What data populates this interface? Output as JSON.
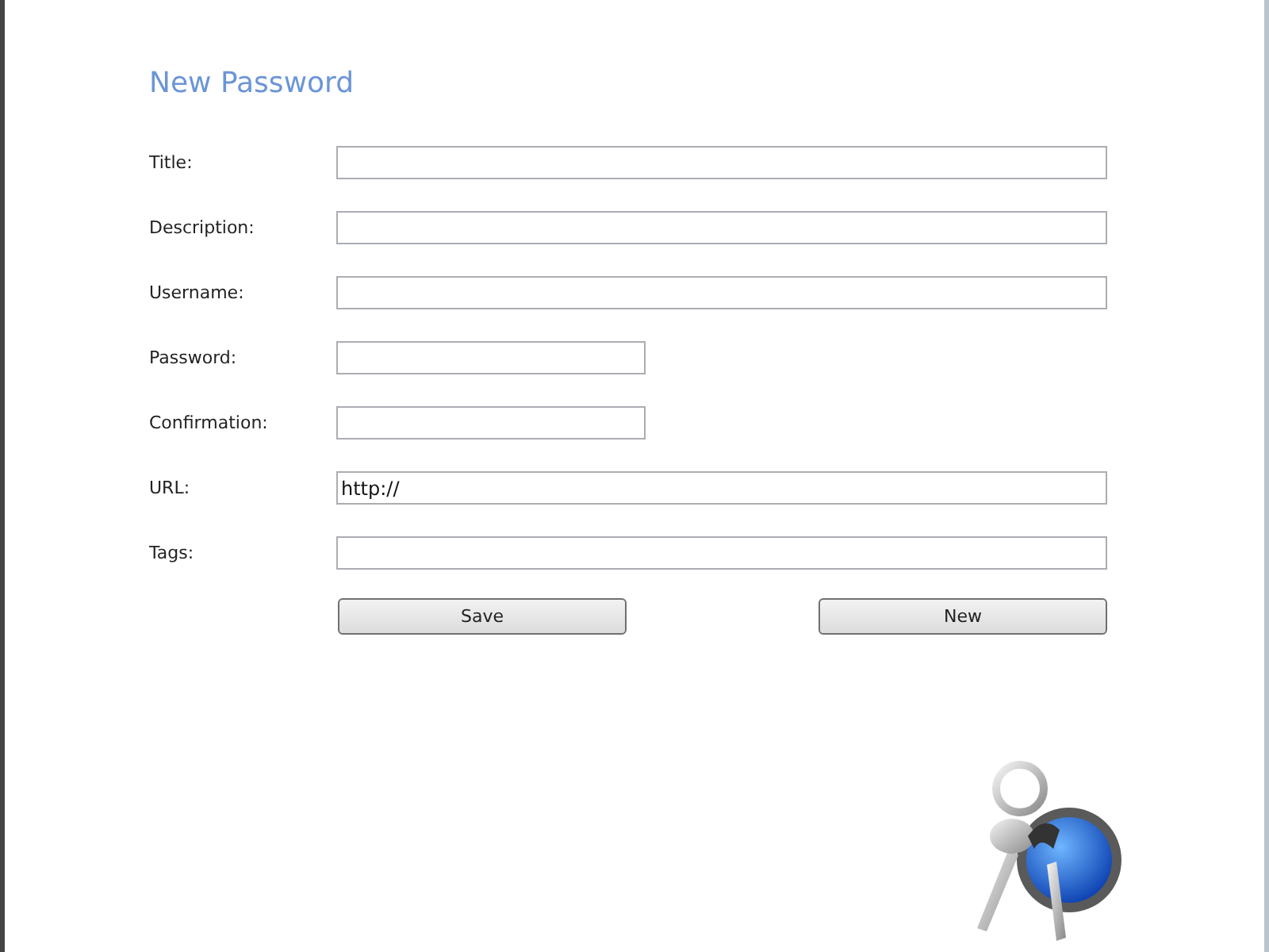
{
  "heading": "New Password",
  "fields": [
    {
      "label": "Title:",
      "kind": "wide"
    },
    {
      "label": "Description:",
      "kind": "wide"
    },
    {
      "label": "Username:",
      "kind": "wide"
    },
    {
      "label": "Password:",
      "kind": "short"
    },
    {
      "label": "Confirmation:",
      "kind": "short"
    },
    {
      "label": "URL:",
      "kind": "wide",
      "value": "http://"
    },
    {
      "label": "Tags:",
      "kind": "wide"
    }
  ],
  "buttons": [
    "Save",
    "New"
  ]
}
